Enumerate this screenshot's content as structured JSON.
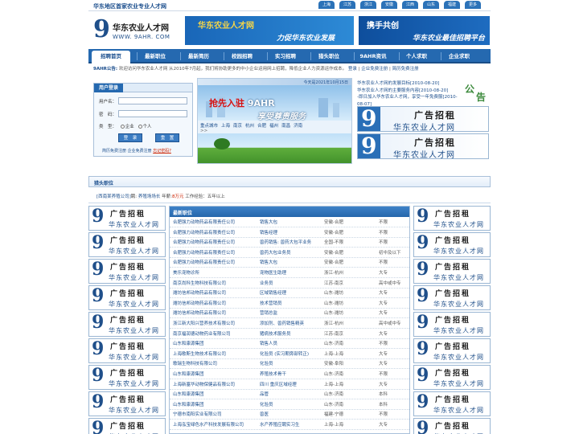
{
  "header": {
    "slogan": "华东地区首家农业专业人才网",
    "cities": [
      "上海",
      "江苏",
      "浙江",
      "安徽",
      "江西",
      "山东",
      "福建",
      "更多"
    ]
  },
  "logo": {
    "glyph": "9",
    "cn": "华东农业人才网",
    "en": "WWW. 9AHR. COM"
  },
  "banners": [
    {
      "line1": "华东农业人才网",
      "line2": "力促华东农业发展"
    },
    {
      "line1": "携手共创",
      "line2": "华东农业最佳招聘平台"
    }
  ],
  "nav": [
    "招聘首页",
    "最新职位",
    "最新简历",
    "校园招聘",
    "实习招聘",
    "猎头职位",
    "9AHR资讯",
    "个人求职",
    "企业求职"
  ],
  "notice": {
    "label": "9AHR公告:",
    "text": "欢迎访问华东农业人才网 从2010年7月起，我们将协助更多的中小企业运用网上招聘，降低企业人力资源运作成本。",
    "login": "登录",
    "reg1": "企业免费注册",
    "reg2": "简历免费注册"
  },
  "login_box": {
    "title": "用户登录",
    "user_label": "用户名：",
    "pass_label": "密　码：",
    "type_label": "类　型：",
    "type_company": "企业",
    "type_person": "个人",
    "login_btn": "登　录",
    "reset_btn": "重　置",
    "link1": "简历免费注册",
    "link2": "企业免费注册",
    "forgot": "忘记密码?"
  },
  "promo": {
    "date": "今天是2021年10月15日",
    "line1_a": "抢先入驻",
    "line1_b": "9AHR",
    "line2": "享受尊贵服务",
    "cities_label": "重点城市",
    "cities": [
      "上海",
      "南京",
      "杭州",
      "合肥",
      "福州",
      "南昌",
      "济南"
    ],
    "more": ">>"
  },
  "news": [
    {
      "text": "华东农业人才网的发展目标",
      "date": "[2010-08-20]"
    },
    {
      "text": "华东农业人才网的主要服务内容",
      "date": "[2010-08-20]"
    },
    {
      "text": "-即日加入华东农业人才网，享受一年免费服",
      "date": "[2010-08-07]"
    }
  ],
  "ribbon": [
    "公",
    "告"
  ],
  "ad": {
    "glyph": "9",
    "line1": "广告招租",
    "line2": "华东农业人才网"
  },
  "hunt": {
    "title": "猎头职位",
    "company": "[西南某养殖公司]",
    "job_label": "聘:",
    "job": "养殖场场长",
    "salary_label": "年薪:",
    "salary": "8万元",
    "exp": "工作经验：五年以上"
  },
  "jobs": {
    "title": "最新职位",
    "rows": [
      [
        "合肥强力动物药品有限责任公司",
        "销售大包",
        "安徽-合肥",
        "不限"
      ],
      [
        "合肥强力动物药品有限责任公司",
        "销售经理",
        "安徽-合肥",
        "不限"
      ],
      [
        "合肥强力动物药品有限责任公司",
        "兽药销售: 兽药大包平业务",
        "全国-不限",
        "不限"
      ],
      [
        "合肥强力动物药品有限责任公司",
        "兽药大包业务员",
        "安徽-合肥",
        "初中及以下"
      ],
      [
        "合肥强力动物药品有限责任公司",
        "销售大包",
        "安徽-合肥",
        "不限"
      ],
      [
        "美乐宠物诊所",
        "宠物医生助理",
        "浙江-杭州",
        "大专"
      ],
      [
        "南京尚科生物科技有限公司",
        "业务员",
        "江苏-南京",
        "高中或中专"
      ],
      [
        "潍坊信邦动物药品有限公司",
        "区域销售经理",
        "山东-潍坊",
        "大专"
      ],
      [
        "潍坊信邦动物药品有限公司",
        "技术营销员",
        "山东-潍坊",
        "大专"
      ],
      [
        "潍坊信邦动物药品有限公司",
        "营销总监",
        "山东-潍坊",
        "大专"
      ],
      [
        "浙江新大阳兴营养技术有限公司",
        "添加剂、兽药销售精英",
        "浙江-杭州",
        "高中或中专"
      ],
      [
        "南京福润德动物药业有限公司",
        "猪病技术服务员",
        "江苏-南京",
        "大专"
      ],
      [
        "山东和康源集团",
        "销售人员",
        "山东-济南",
        "不限"
      ],
      [
        "上海歌斯生物技术有限公司",
        "化验员 (实习期旁部转正)",
        "上海-上海",
        "大专"
      ],
      [
        "歌瑞生物科技有限公司",
        "化验员",
        "安徽-阜阳",
        "大专"
      ],
      [
        "山东和康源集团",
        "养殖技术骨干",
        "山东-济南",
        "不限"
      ],
      [
        "上海新塞华动物保健品有限公司",
        "四川 重庆区域经理",
        "上海-上海",
        "大专"
      ],
      [
        "山东和康源集团",
        "品管",
        "山东-济南",
        "本科"
      ],
      [
        "山东和康源集团",
        "化验员",
        "山东-济南",
        "本科"
      ],
      [
        "宁德市南阳实业有限公司",
        "兽医",
        "福建-宁德",
        "不限"
      ],
      [
        "上海泓宝绿色水产科技发展有限公司",
        "水产养殖应聘实习生",
        "上海-上海",
        "大专"
      ]
    ]
  },
  "colors": {
    "brand": "#2569b0",
    "dark": "#1a4d8c",
    "accent_red": "#cc2200",
    "ad_green": "#3c8a3c"
  }
}
